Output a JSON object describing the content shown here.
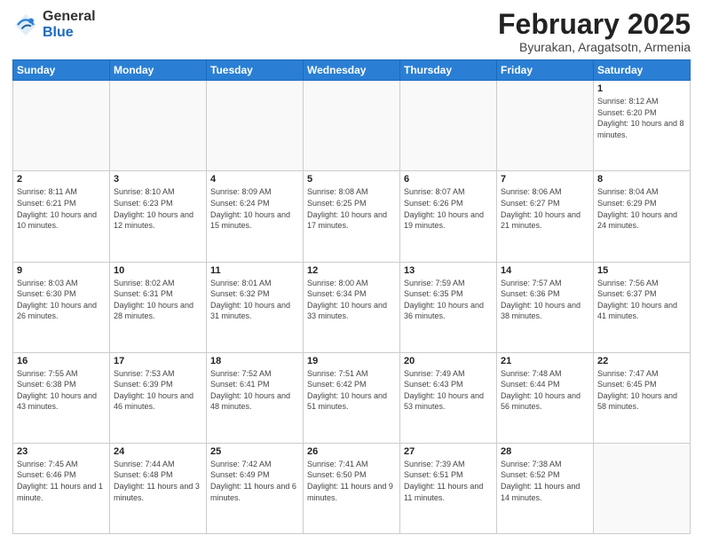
{
  "logo": {
    "general": "General",
    "blue": "Blue"
  },
  "title": "February 2025",
  "subtitle": "Byurakan, Aragatsotn, Armenia",
  "days_of_week": [
    "Sunday",
    "Monday",
    "Tuesday",
    "Wednesday",
    "Thursday",
    "Friday",
    "Saturday"
  ],
  "weeks": [
    [
      {
        "day": "",
        "info": ""
      },
      {
        "day": "",
        "info": ""
      },
      {
        "day": "",
        "info": ""
      },
      {
        "day": "",
        "info": ""
      },
      {
        "day": "",
        "info": ""
      },
      {
        "day": "",
        "info": ""
      },
      {
        "day": "1",
        "info": "Sunrise: 8:12 AM\nSunset: 6:20 PM\nDaylight: 10 hours and 8 minutes."
      }
    ],
    [
      {
        "day": "2",
        "info": "Sunrise: 8:11 AM\nSunset: 6:21 PM\nDaylight: 10 hours and 10 minutes."
      },
      {
        "day": "3",
        "info": "Sunrise: 8:10 AM\nSunset: 6:23 PM\nDaylight: 10 hours and 12 minutes."
      },
      {
        "day": "4",
        "info": "Sunrise: 8:09 AM\nSunset: 6:24 PM\nDaylight: 10 hours and 15 minutes."
      },
      {
        "day": "5",
        "info": "Sunrise: 8:08 AM\nSunset: 6:25 PM\nDaylight: 10 hours and 17 minutes."
      },
      {
        "day": "6",
        "info": "Sunrise: 8:07 AM\nSunset: 6:26 PM\nDaylight: 10 hours and 19 minutes."
      },
      {
        "day": "7",
        "info": "Sunrise: 8:06 AM\nSunset: 6:27 PM\nDaylight: 10 hours and 21 minutes."
      },
      {
        "day": "8",
        "info": "Sunrise: 8:04 AM\nSunset: 6:29 PM\nDaylight: 10 hours and 24 minutes."
      }
    ],
    [
      {
        "day": "9",
        "info": "Sunrise: 8:03 AM\nSunset: 6:30 PM\nDaylight: 10 hours and 26 minutes."
      },
      {
        "day": "10",
        "info": "Sunrise: 8:02 AM\nSunset: 6:31 PM\nDaylight: 10 hours and 28 minutes."
      },
      {
        "day": "11",
        "info": "Sunrise: 8:01 AM\nSunset: 6:32 PM\nDaylight: 10 hours and 31 minutes."
      },
      {
        "day": "12",
        "info": "Sunrise: 8:00 AM\nSunset: 6:34 PM\nDaylight: 10 hours and 33 minutes."
      },
      {
        "day": "13",
        "info": "Sunrise: 7:59 AM\nSunset: 6:35 PM\nDaylight: 10 hours and 36 minutes."
      },
      {
        "day": "14",
        "info": "Sunrise: 7:57 AM\nSunset: 6:36 PM\nDaylight: 10 hours and 38 minutes."
      },
      {
        "day": "15",
        "info": "Sunrise: 7:56 AM\nSunset: 6:37 PM\nDaylight: 10 hours and 41 minutes."
      }
    ],
    [
      {
        "day": "16",
        "info": "Sunrise: 7:55 AM\nSunset: 6:38 PM\nDaylight: 10 hours and 43 minutes."
      },
      {
        "day": "17",
        "info": "Sunrise: 7:53 AM\nSunset: 6:39 PM\nDaylight: 10 hours and 46 minutes."
      },
      {
        "day": "18",
        "info": "Sunrise: 7:52 AM\nSunset: 6:41 PM\nDaylight: 10 hours and 48 minutes."
      },
      {
        "day": "19",
        "info": "Sunrise: 7:51 AM\nSunset: 6:42 PM\nDaylight: 10 hours and 51 minutes."
      },
      {
        "day": "20",
        "info": "Sunrise: 7:49 AM\nSunset: 6:43 PM\nDaylight: 10 hours and 53 minutes."
      },
      {
        "day": "21",
        "info": "Sunrise: 7:48 AM\nSunset: 6:44 PM\nDaylight: 10 hours and 56 minutes."
      },
      {
        "day": "22",
        "info": "Sunrise: 7:47 AM\nSunset: 6:45 PM\nDaylight: 10 hours and 58 minutes."
      }
    ],
    [
      {
        "day": "23",
        "info": "Sunrise: 7:45 AM\nSunset: 6:46 PM\nDaylight: 11 hours and 1 minute."
      },
      {
        "day": "24",
        "info": "Sunrise: 7:44 AM\nSunset: 6:48 PM\nDaylight: 11 hours and 3 minutes."
      },
      {
        "day": "25",
        "info": "Sunrise: 7:42 AM\nSunset: 6:49 PM\nDaylight: 11 hours and 6 minutes."
      },
      {
        "day": "26",
        "info": "Sunrise: 7:41 AM\nSunset: 6:50 PM\nDaylight: 11 hours and 9 minutes."
      },
      {
        "day": "27",
        "info": "Sunrise: 7:39 AM\nSunset: 6:51 PM\nDaylight: 11 hours and 11 minutes."
      },
      {
        "day": "28",
        "info": "Sunrise: 7:38 AM\nSunset: 6:52 PM\nDaylight: 11 hours and 14 minutes."
      },
      {
        "day": "",
        "info": ""
      }
    ]
  ]
}
